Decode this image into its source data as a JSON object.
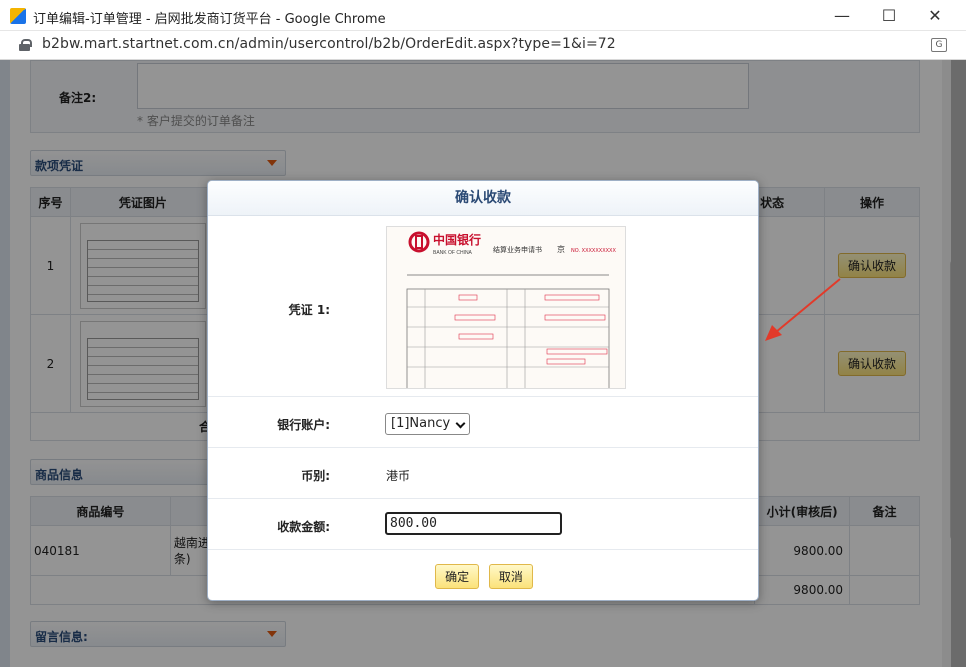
{
  "browser": {
    "title": "订单编辑-订单管理 - 启网批发商订货平台 - Google Chrome",
    "url": "b2bw.mart.startnet.com.cn/admin/usercontrol/b2b/OrderEdit.aspx?type=1&i=72",
    "minimize_glyph": "—",
    "maximize_glyph": "☐",
    "close_glyph": "✕"
  },
  "page": {
    "remark_label": "备注2:",
    "remark_hint": "* 客户提交的订单备注",
    "payment_section_title": "款项凭证",
    "payment_table": {
      "headers": [
        "序号",
        "凭证图片",
        "状态",
        "操作"
      ],
      "rows": [
        {
          "index": "1",
          "action": "确认收款"
        },
        {
          "index": "2",
          "action": "确认收款"
        }
      ],
      "total_label": "合"
    },
    "product_section_title": "商品信息",
    "product_table": {
      "headers": [
        "商品编号",
        "小计(审核后)",
        "备注"
      ],
      "rows": [
        {
          "code": "040181",
          "name_part1": "越南进",
          "name_part2": "条)",
          "subtotal": "9800.00"
        }
      ],
      "total_subtotal": "9800.00"
    },
    "message_section_title": "留言信息:"
  },
  "dialog": {
    "title": "确认收款",
    "voucher_label": "凭证 1:",
    "voucher_image": {
      "bank_name": "中国银行",
      "bank_en": "BANK OF CHINA",
      "form_title": "结算业务申请书",
      "region": "京",
      "number": "NO. XXXXXXXXXX"
    },
    "bank_account_label": "银行账户:",
    "bank_account_value": "[1]Nancy",
    "currency_label": "币别:",
    "currency_value": "港币",
    "amount_label": "收款金额:",
    "amount_value": "800.00",
    "ok_label": "确定",
    "cancel_label": "取消"
  },
  "colors": {
    "accent_button": "#fbe27a",
    "section_title": "#2a4c7a",
    "arrow": "#e23a2a"
  }
}
